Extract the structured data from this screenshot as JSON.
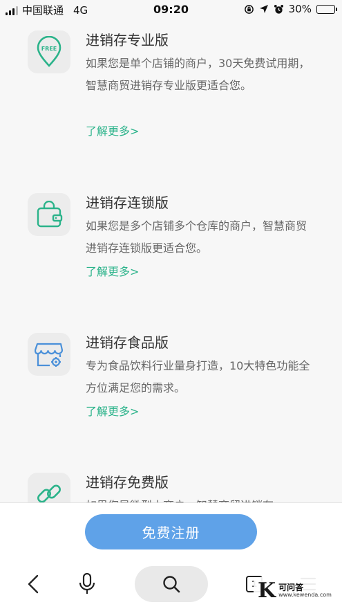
{
  "status_bar": {
    "carrier": "中国联通",
    "network": "4G",
    "time": "09:20",
    "battery": "30%",
    "battery_level": 0.3
  },
  "products": [
    {
      "title": "进销存专业版",
      "description": "如果您是单个店铺的商户，30天免费试用期，智慧商贸进销存专业版更适合您。",
      "link": "了解更多>",
      "icon": "free-location-pin-icon",
      "icon_text": "FREE"
    },
    {
      "title": "进销存连锁版",
      "description": "如果您是多个店铺多个仓库的商户，智慧商贸进销存连锁版更适合您。",
      "link": "了解更多>",
      "icon": "wallet-bag-icon"
    },
    {
      "title": "进销存食品版",
      "description": "专为食品饮料行业量身打造，10大特色功能全方位满足您的需求。",
      "link": "了解更多>",
      "icon": "storefront-gear-icon"
    },
    {
      "title": "进销存免费版",
      "description": "如果您是微型小商户，智慧商贸进销存",
      "icon": "link-chain-icon"
    }
  ],
  "register_button": "免费注册",
  "nav": {
    "tab_count": "1"
  },
  "watermark": {
    "logo_letter": "K",
    "name": "可问答",
    "url": "www.kewenda.com"
  },
  "colors": {
    "accent_green": "#2bb38a",
    "register_blue": "#5fa2e8",
    "icon_blue": "#4a90d9"
  }
}
